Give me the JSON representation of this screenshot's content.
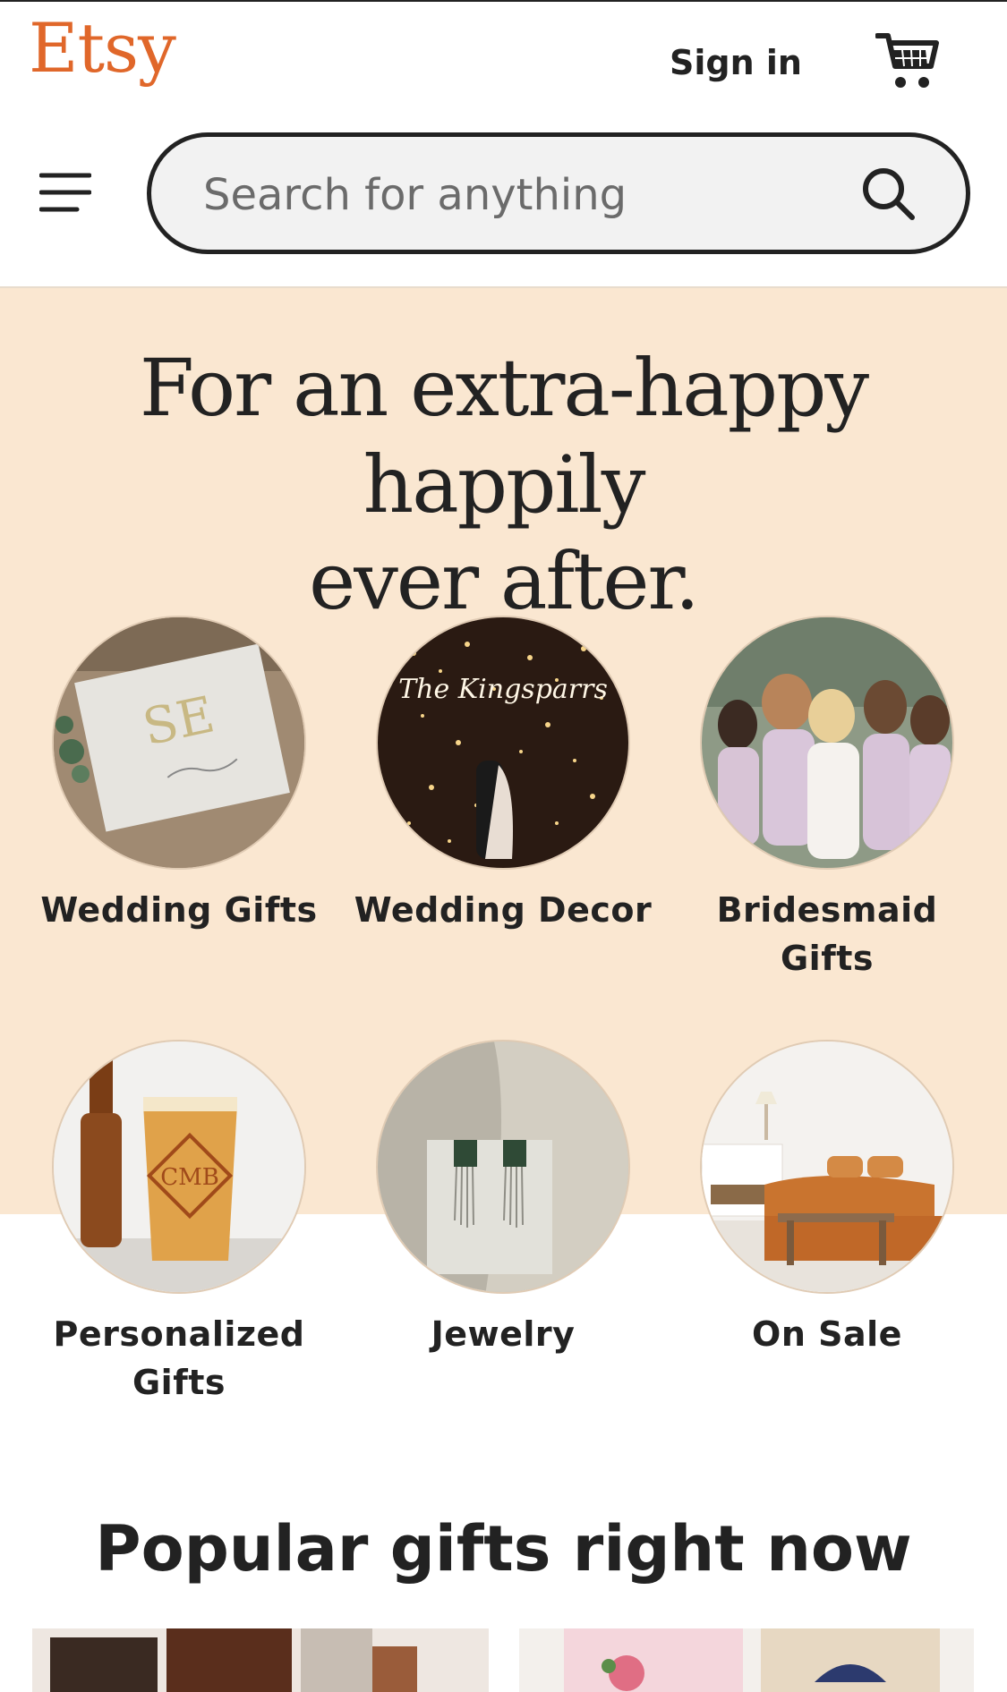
{
  "header": {
    "logo_text": "Etsy",
    "sign_in_label": "Sign in",
    "search_placeholder": "Search for anything",
    "cart_icon": "cart-icon",
    "menu_icon": "hamburger-menu-icon",
    "search_icon": "search-icon"
  },
  "hero": {
    "title_line1": "For an extra-happy happily",
    "title_line2": "ever after."
  },
  "categories": [
    {
      "line1": "Wedding Gifts",
      "line2": ""
    },
    {
      "line1": "Wedding Decor",
      "line2": ""
    },
    {
      "line1": "Bridesmaid",
      "line2": "Gifts"
    },
    {
      "line1": "Personalized",
      "line2": "Gifts"
    },
    {
      "line1": "Jewelry",
      "line2": ""
    },
    {
      "line1": "On Sale",
      "line2": ""
    }
  ],
  "popular": {
    "heading": "Popular gifts right now"
  },
  "colors": {
    "brand": "#e0672a",
    "hero_background": "#fae7d1",
    "text": "#222222"
  }
}
